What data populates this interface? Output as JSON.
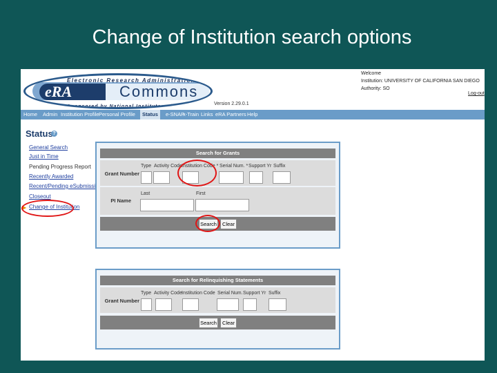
{
  "slide": {
    "title": "Change of Institution search options"
  },
  "header": {
    "era_title": "Electronic Research Administration",
    "era_mark": "eRA",
    "commons": "Commons",
    "sponsor": "Sponsored by National Institutes of Health",
    "version": "Version 2.29.0.1",
    "welcome": "Welcome",
    "institution": "Institution: UNIVERSITY OF CALIFORNIA SAN DIEGO",
    "authority": "Authority: SO",
    "logout": "Log-out"
  },
  "nav": {
    "items": [
      "Home",
      "Admin",
      "Institution Profile",
      "Personal Profile",
      "Status",
      "e-SNAP",
      "x-Train",
      "Links",
      "eRA Partners",
      "Help"
    ],
    "active": "Status"
  },
  "sidebar": {
    "title": "Status",
    "links": [
      "General Search",
      "Just in Time",
      "Pending Progress Report",
      "Recently Awarded",
      "Recent/Pending eSubmissions",
      "Closeout",
      "Change of Institution"
    ]
  },
  "search_grants": {
    "header": "Search for Grants",
    "grant_number_label": "Grant Number",
    "columns": [
      "Type",
      "Activity Code",
      "Institution Code *",
      "Serial Num. *",
      "Support Yr",
      "Suffix"
    ],
    "pi_name_label": "PI Name",
    "last_label": "Last",
    "first_label": "First",
    "search_button": "Search",
    "clear_button": "Clear"
  },
  "search_relinquishing": {
    "header": "Search for Relinquishing Statements",
    "grant_number_label": "Grant Number",
    "columns": [
      "Type",
      "Activity Code",
      "Institution Code",
      "Serial Num.",
      "Support Yr",
      "Suffix"
    ],
    "search_button": "Search",
    "clear_button": "Clear"
  },
  "colors": {
    "background": "#0f5656",
    "nav": "#6a9cc8",
    "panel_head": "#808080",
    "highlight": "#e01515"
  }
}
